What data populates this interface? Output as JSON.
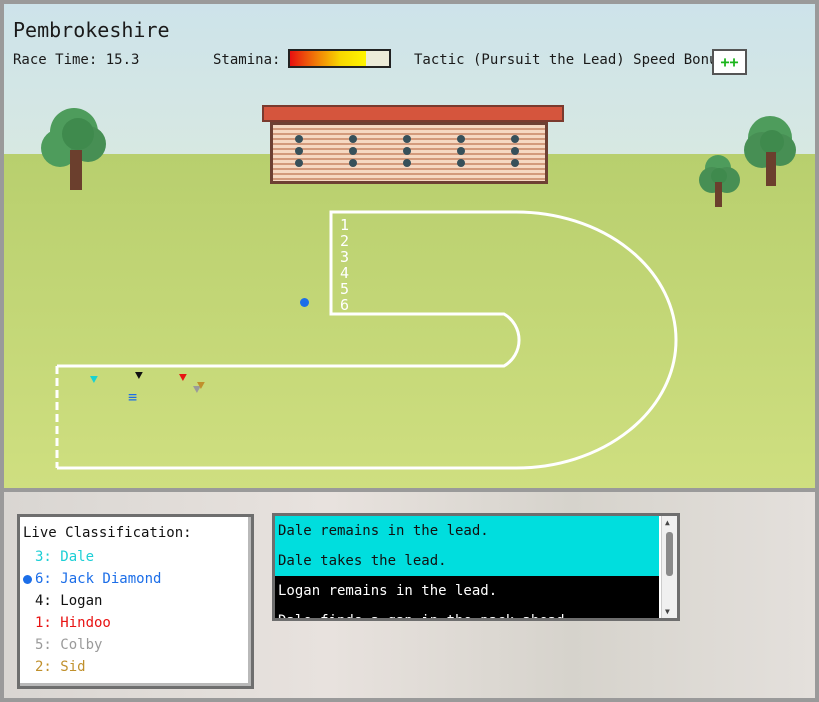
{
  "race": {
    "venue": "Pembrokeshire",
    "race_time_label": "Race Time:",
    "race_time_value": "15.3",
    "stamina_label": "Stamina:",
    "stamina_level": 0.77,
    "tactic_label": "Tactic (Pursuit the Lead)",
    "speed_bonus_label": "Speed Bonus:",
    "speed_bonus_value": "++"
  },
  "track": {
    "lane_numbers": [
      "1",
      "2",
      "3",
      "4",
      "5",
      "6"
    ]
  },
  "racers": [
    {
      "name": "Dale",
      "color": "#18d2d2",
      "icon": "shirt-icon"
    },
    {
      "name": "Logan",
      "color": "#111111",
      "icon": "shirt-icon"
    },
    {
      "name": "Hindoo",
      "color": "#e81313",
      "icon": "shirt-icon"
    },
    {
      "name": "Colby",
      "color": "#9a9a9a",
      "icon": "shirt-icon"
    },
    {
      "name": "Sid",
      "color": "#c0902c",
      "icon": "shirt-icon"
    },
    {
      "name": "Jack Diamond",
      "color": "#1c6ee8",
      "icon": "stripes-icon"
    }
  ],
  "classification": {
    "title": "Live Classification:",
    "selected_index": 1,
    "rows": [
      {
        "text": "3: Dale",
        "color": "#1ccfd6"
      },
      {
        "text": "6: Jack Diamond",
        "color": "#1c6ee8"
      },
      {
        "text": "4: Logan",
        "color": "#111111"
      },
      {
        "text": "1: Hindoo",
        "color": "#e81313"
      },
      {
        "text": "5: Colby",
        "color": "#9a9a9a"
      },
      {
        "text": "2: Sid",
        "color": "#c0902c"
      }
    ]
  },
  "log": {
    "messages": [
      {
        "text": "Dale remains in the lead.",
        "bg": "#00dede",
        "fg": "#111111"
      },
      {
        "text": "Dale takes the lead.",
        "bg": "#00dede",
        "fg": "#111111"
      },
      {
        "text": "Logan remains in the lead.",
        "bg": "#000000",
        "fg": "#ffffff"
      },
      {
        "text": "Dale finds a gap in the pack ahead.",
        "bg": "#000000",
        "fg": "#ffffff"
      }
    ]
  }
}
